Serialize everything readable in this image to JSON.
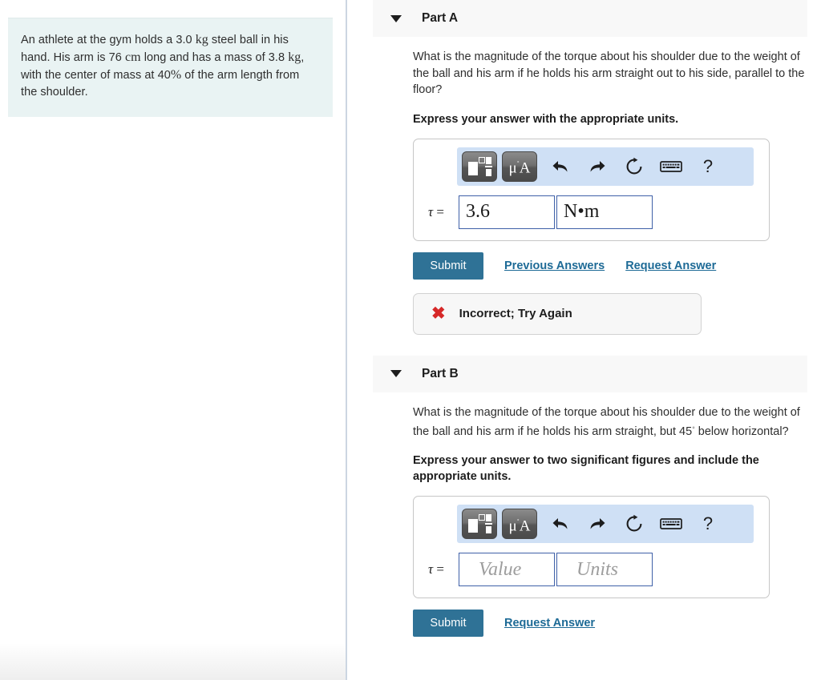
{
  "problem": {
    "segments": [
      {
        "t": "An athlete at the gym holds a 3.0 ",
        "m": false
      },
      {
        "t": "kg",
        "m": true
      },
      {
        "t": " steel ball in his hand. His arm is 76 ",
        "m": false
      },
      {
        "t": "cm",
        "m": true
      },
      {
        "t": " long and has a mass of 3.8 ",
        "m": false
      },
      {
        "t": "kg",
        "m": true
      },
      {
        "t": ", with the center of mass at 40",
        "m": false
      },
      {
        "t": "%",
        "m": true
      },
      {
        "t": " of the arm length from the shoulder.",
        "m": false
      }
    ],
    "plain": "An athlete at the gym holds a 3.0 kg steel ball in his hand. His arm is 76 cm long and has a mass of 3.8 kg, with the center of mass at 40% of the arm length from the shoulder."
  },
  "toolbar": {
    "template_button_label": "math-template",
    "units_button_label": "μA",
    "units_button_mu": "μ",
    "units_button_a": "A",
    "undo_label": "undo",
    "redo_label": "redo",
    "reset_label": "reset",
    "keyboard_label": "keyboard",
    "help_label": "?"
  },
  "colors": {
    "accent_button": "#2f7296",
    "link": "#1d6a96",
    "toolbar_bg": "#cfe0f5",
    "problem_bg": "#e9f3f3",
    "part_header_bg": "#f8f8f8",
    "field_border": "#3f60a8",
    "error_mark": "#d62828",
    "feedback_bg": "#f7f7f7"
  },
  "parts": [
    {
      "id": "part-a",
      "caret": "▼",
      "title": "Part A",
      "question": "What is the magnitude of the torque about his shoulder due to the weight of the ball and his arm if he holds his arm straight out to his side, parallel to the floor?",
      "question_pre": "What is the magnitude of the torque about his shoulder due to the weight of the ball and his arm if he holds his arm straight out to his side, parallel to the floor?",
      "instruction": "Express your answer with the appropriate units.",
      "answer": {
        "symbol": "τ",
        "equals": "=",
        "value": "3.6",
        "value_placeholder": "Value",
        "units": "N•m",
        "units_placeholder": "Units"
      },
      "buttons": {
        "submit": "Submit",
        "previous_answers": "Previous Answers",
        "request_answer": "Request Answer"
      },
      "feedback": {
        "icon": "✖",
        "text": "Incorrect; Try Again"
      }
    },
    {
      "id": "part-b",
      "caret": "▼",
      "title": "Part B",
      "question_pre": "What is the magnitude of the torque about his shoulder due to the weight of the ball and his arm if he holds his arm straight, but 45",
      "question_deg": "◦",
      "question_post": " below horizontal?",
      "question": "What is the magnitude of the torque about his shoulder due to the weight of the ball and his arm if he holds his arm straight, but 45° below horizontal?",
      "instruction": "Express your answer to two significant figures and include the appropriate units.",
      "answer": {
        "symbol": "τ",
        "equals": "=",
        "value": "",
        "value_placeholder": "Value",
        "units": "",
        "units_placeholder": "Units"
      },
      "buttons": {
        "submit": "Submit",
        "request_answer": "Request Answer"
      }
    }
  ]
}
